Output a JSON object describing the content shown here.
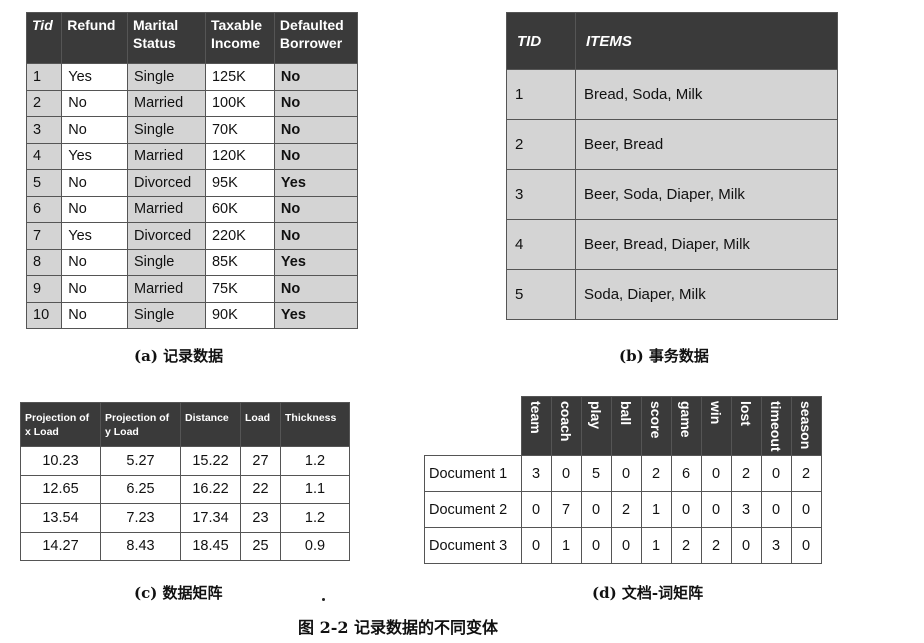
{
  "table_a": {
    "headers": [
      {
        "line1": "Tid",
        "line2": ""
      },
      {
        "line1": "Refund",
        "line2": ""
      },
      {
        "line1": "Marital",
        "line2": "Status"
      },
      {
        "line1": "Taxable",
        "line2": "Income"
      },
      {
        "line1": "Defaulted",
        "line2": "Borrower"
      }
    ],
    "rows": [
      [
        "1",
        "Yes",
        "Single",
        "125K",
        "No"
      ],
      [
        "2",
        "No",
        "Married",
        "100K",
        "No"
      ],
      [
        "3",
        "No",
        "Single",
        "70K",
        "No"
      ],
      [
        "4",
        "Yes",
        "Married",
        "120K",
        "No"
      ],
      [
        "5",
        "No",
        "Divorced",
        "95K",
        "Yes"
      ],
      [
        "6",
        "No",
        "Married",
        "60K",
        "No"
      ],
      [
        "7",
        "Yes",
        "Divorced",
        "220K",
        "No"
      ],
      [
        "8",
        "No",
        "Single",
        "85K",
        "Yes"
      ],
      [
        "9",
        "No",
        "Married",
        "75K",
        "No"
      ],
      [
        "10",
        "No",
        "Single",
        "90K",
        "Yes"
      ]
    ],
    "caption": "(a) 记录数据"
  },
  "table_b": {
    "headers": [
      "TID",
      "ITEMS"
    ],
    "rows": [
      [
        "1",
        "Bread, Soda, Milk"
      ],
      [
        "2",
        "Beer, Bread"
      ],
      [
        "3",
        "Beer, Soda, Diaper, Milk"
      ],
      [
        "4",
        "Beer, Bread, Diaper, Milk"
      ],
      [
        "5",
        "Soda, Diaper, Milk"
      ]
    ],
    "caption": "(b) 事务数据"
  },
  "table_c": {
    "headers": [
      {
        "line1": "Projection of",
        "line2": "x Load"
      },
      {
        "line1": "Projection of",
        "line2": "y Load"
      },
      {
        "line1": "Distance",
        "line2": ""
      },
      {
        "line1": "Load",
        "line2": ""
      },
      {
        "line1": "Thickness",
        "line2": ""
      }
    ],
    "rows": [
      [
        "10.23",
        "5.27",
        "15.22",
        "27",
        "1.2"
      ],
      [
        "12.65",
        "6.25",
        "16.22",
        "22",
        "1.1"
      ],
      [
        "13.54",
        "7.23",
        "17.34",
        "23",
        "1.2"
      ],
      [
        "14.27",
        "8.43",
        "18.45",
        "25",
        "0.9"
      ]
    ],
    "caption": "(c) 数据矩阵"
  },
  "table_d": {
    "terms": [
      "team",
      "coach",
      "play",
      "ball",
      "score",
      "game",
      "win",
      "lost",
      "timeout",
      "season"
    ],
    "rows": [
      {
        "label": "Document 1",
        "values": [
          "3",
          "0",
          "5",
          "0",
          "2",
          "6",
          "0",
          "2",
          "0",
          "2"
        ]
      },
      {
        "label": "Document 2",
        "values": [
          "0",
          "7",
          "0",
          "2",
          "1",
          "0",
          "0",
          "3",
          "0",
          "0"
        ]
      },
      {
        "label": "Document 3",
        "values": [
          "0",
          "1",
          "0",
          "0",
          "1",
          "2",
          "2",
          "0",
          "3",
          "0"
        ]
      }
    ],
    "caption": "(d) 文档-词矩阵"
  },
  "figure_caption": "图 2-2   记录数据的不同变体"
}
